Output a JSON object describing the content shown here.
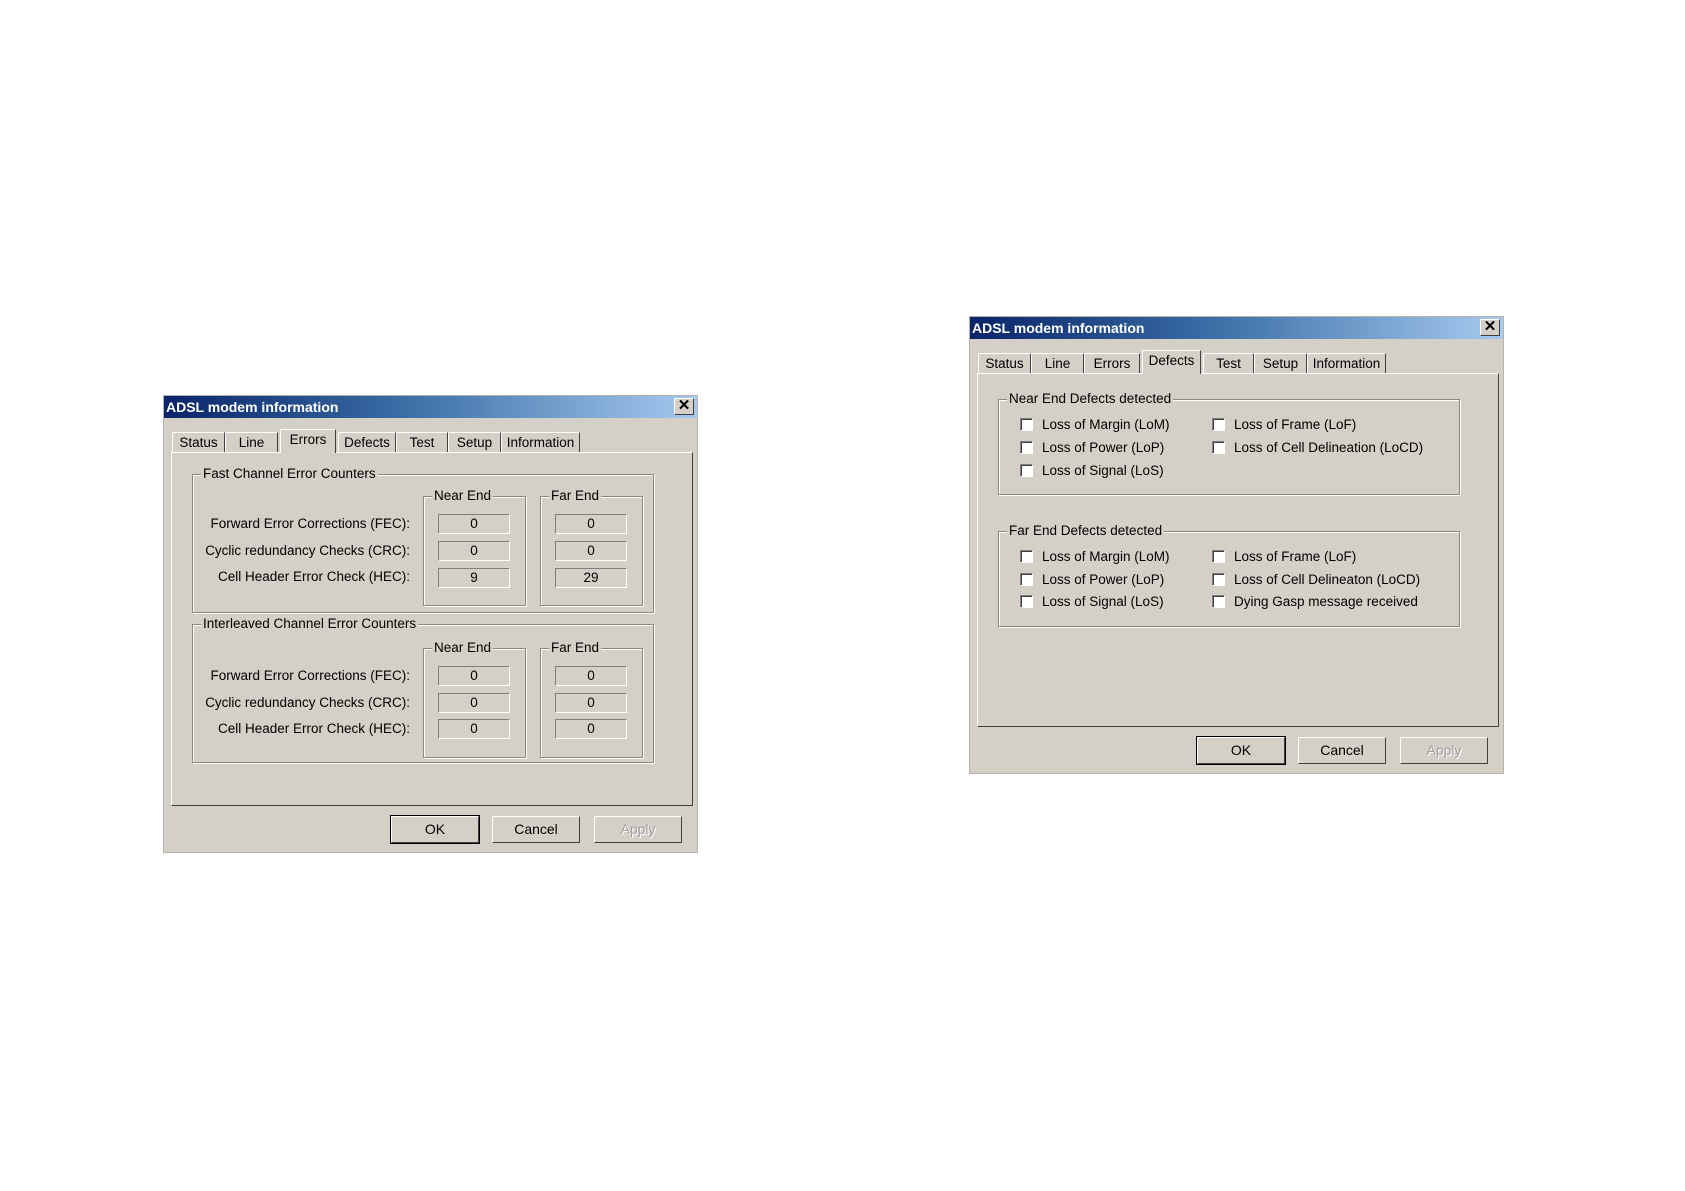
{
  "dialogs": [
    {
      "title": "ADSL modem information",
      "tabs": [
        "Status",
        "Line",
        "Errors",
        "Defects",
        "Test",
        "Setup",
        "Information"
      ],
      "active_tab": "Errors",
      "fast": {
        "title": "Fast Channel Error Counters",
        "near_end": "Near End",
        "far_end": "Far End",
        "rows": [
          {
            "label": "Forward Error Corrections (FEC):",
            "near": "0",
            "far": "0"
          },
          {
            "label": "Cyclic redundancy Checks (CRC):",
            "near": "0",
            "far": "0"
          },
          {
            "label": "Cell Header Error Check (HEC):",
            "near": "9",
            "far": "29"
          }
        ]
      },
      "interleaved": {
        "title": "Interleaved Channel Error Counters",
        "near_end": "Near End",
        "far_end": "Far End",
        "rows": [
          {
            "label": "Forward Error Corrections (FEC):",
            "near": "0",
            "far": "0"
          },
          {
            "label": "Cyclic redundancy Checks (CRC):",
            "near": "0",
            "far": "0"
          },
          {
            "label": "Cell Header Error Check (HEC):",
            "near": "0",
            "far": "0"
          }
        ]
      },
      "buttons": {
        "ok": "OK",
        "cancel": "Cancel",
        "apply": "Apply"
      }
    },
    {
      "title": "ADSL modem information",
      "tabs": [
        "Status",
        "Line",
        "Errors",
        "Defects",
        "Test",
        "Setup",
        "Information"
      ],
      "active_tab": "Defects",
      "near_defects": {
        "title": "Near End Defects detected",
        "items": [
          "Loss of Margin (LoM)",
          "Loss of Frame (LoF)",
          "Loss of Power (LoP)",
          "Loss of Cell Delineation  (LoCD)",
          "Loss of Signal (LoS)"
        ]
      },
      "far_defects": {
        "title": "Far End Defects detected",
        "items": [
          "Loss of Margin (LoM)",
          "Loss of Frame (LoF)",
          "Loss of Power (LoP)",
          "Loss of Cell Delineaton  (LoCD)",
          "Loss of Signal (LoS)",
          "Dying Gasp message received"
        ]
      },
      "buttons": {
        "ok": "OK",
        "cancel": "Cancel",
        "apply": "Apply"
      }
    }
  ]
}
